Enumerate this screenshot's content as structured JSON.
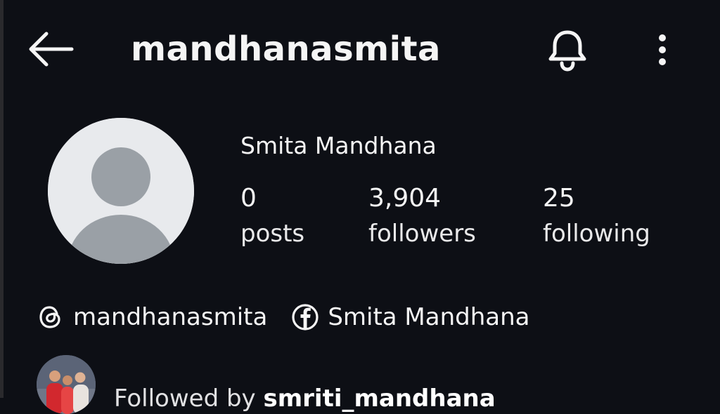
{
  "header": {
    "username": "mandhanasmita",
    "back_icon": "arrow-left-icon",
    "notification_icon": "bell-icon",
    "menu_icon": "more-vertical-icon"
  },
  "profile": {
    "display_name": "Smita Mandhana",
    "avatar_icon": "default-avatar-icon",
    "stats": [
      {
        "value": "0",
        "label": "posts"
      },
      {
        "value": "3,904",
        "label": "followers"
      },
      {
        "value": "25",
        "label": "following"
      }
    ]
  },
  "links": [
    {
      "icon": "threads-icon",
      "text": "mandhanasmita"
    },
    {
      "icon": "facebook-icon",
      "text": "Smita Mandhana"
    }
  ],
  "followed_by": {
    "prefix": "Followed by",
    "username": "smriti_mandhana"
  },
  "colors": {
    "background": "#0d0f15",
    "text": "#f5f5f5",
    "avatar_bg": "#e8eaed",
    "avatar_silhouette": "#9aa0a6"
  }
}
